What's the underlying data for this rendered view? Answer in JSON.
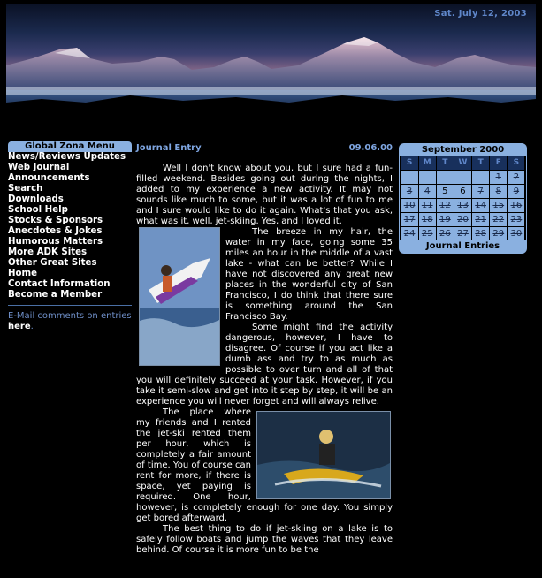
{
  "header": {
    "date": "Sat. July 12, 2003"
  },
  "nav": {
    "title": "Global Zona Menu",
    "items": [
      "News/Reviews Updates",
      "Web Journal",
      "Announcements",
      "Search",
      "Downloads",
      "School Help",
      "Stocks & Sponsors",
      "Anecdotes & Jokes",
      "Humorous Matters",
      "More ADK Sites",
      "Other Great Sites",
      "Home",
      "Contact Information",
      "Become a Member"
    ],
    "email_prefix": "E-Mail comments on entries ",
    "email_link": "here",
    "email_suffix": "."
  },
  "entry": {
    "title": "Journal Entry",
    "date": "09.06.00",
    "p1": "Well I don't know about you, but I sure had a fun-filled weekend. Besides going out during the nights, I added to my experience a new activity. It may not sounds like much to some, but it was a lot of fun to me and I sure would like to do it again. What's that you ask, what was it, well, jet-skiing. Yes, and I loved it.",
    "p2": "The breeze in my hair, the water in my face, going some 35 miles an hour in the middle of a vast lake - what can be better? While I have not discovered any great new places in the wonderful city of San Francisco, I do think that there sure is something around the San Francisco Bay.",
    "p3": "Some might find the activity dangerous, however, I have to disagree. Of course if you act like a dumb ass and try to as much as possible to over turn and all of that you will definitely succeed at your task. However, if you take it semi-slow and get into it step by step, it will be an experience you will never forget and will always relive.",
    "p4": "The place where my friends and I rented the jet-ski rented them per hour, which is completely a fair amount of time. You of course can rent for more, if there is space, yet paying is required. One hour, however, is completely enough for one day. You simply get bored afterward.",
    "p5": "The best thing to do if jet-skiing on a lake is to safely follow boats and jump the waves that they leave behind. Of course it is more fun to be the"
  },
  "calendar": {
    "title": "September 2000",
    "day_headers": [
      "S",
      "M",
      "T",
      "W",
      "T",
      "F",
      "S"
    ],
    "weeks": [
      [
        "",
        "",
        "",
        "",
        "",
        "1",
        "2"
      ],
      [
        "3",
        "4",
        "5",
        "6",
        "7",
        "8",
        "9"
      ],
      [
        "10",
        "11",
        "12",
        "13",
        "14",
        "15",
        "16"
      ],
      [
        "17",
        "18",
        "19",
        "20",
        "21",
        "22",
        "23"
      ],
      [
        "24",
        "25",
        "26",
        "27",
        "28",
        "29",
        "30"
      ]
    ],
    "footer": "Journal Entries"
  }
}
